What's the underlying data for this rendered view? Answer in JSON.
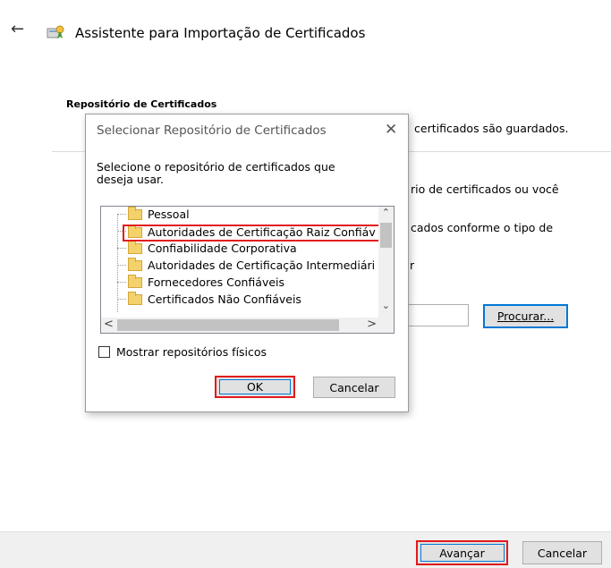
{
  "header": {
    "back_icon": "back-arrow-icon",
    "wizard_icon": "certificate-wizard-icon",
    "title": "Assistente para Importação de Certificados"
  },
  "page": {
    "section_heading": "Repositório de Certificados",
    "line1": "certificados são guardados.",
    "line2": "rio de certificados ou você",
    "line3": "cados conforme o tipo de",
    "fragment": "r",
    "browse_label": "Procurar..."
  },
  "footer": {
    "next_label": "Avançar",
    "cancel_label": "Cancelar"
  },
  "dialog": {
    "title": "Selecionar Repositório de Certificados",
    "close_glyph": "✕",
    "prompt": "Selecione o repositório de certificados que deseja usar.",
    "tree_items": [
      "Pessoal",
      "Autoridades de Certificação Raiz Confiáv",
      "Confiabilidade Corporativa",
      "Autoridades de Certificação Intermediári",
      "Fornecedores Confiáveis",
      "Certificados Não Confiáveis"
    ],
    "selected_index": 1,
    "show_physical_label": "Mostrar repositórios físicos",
    "show_physical_checked": false,
    "ok_label": "OK",
    "cancel_label": "Cancelar"
  },
  "colors": {
    "highlight": "#e21a1a",
    "focus": "#0078d7",
    "folder": "#f3d16b"
  }
}
